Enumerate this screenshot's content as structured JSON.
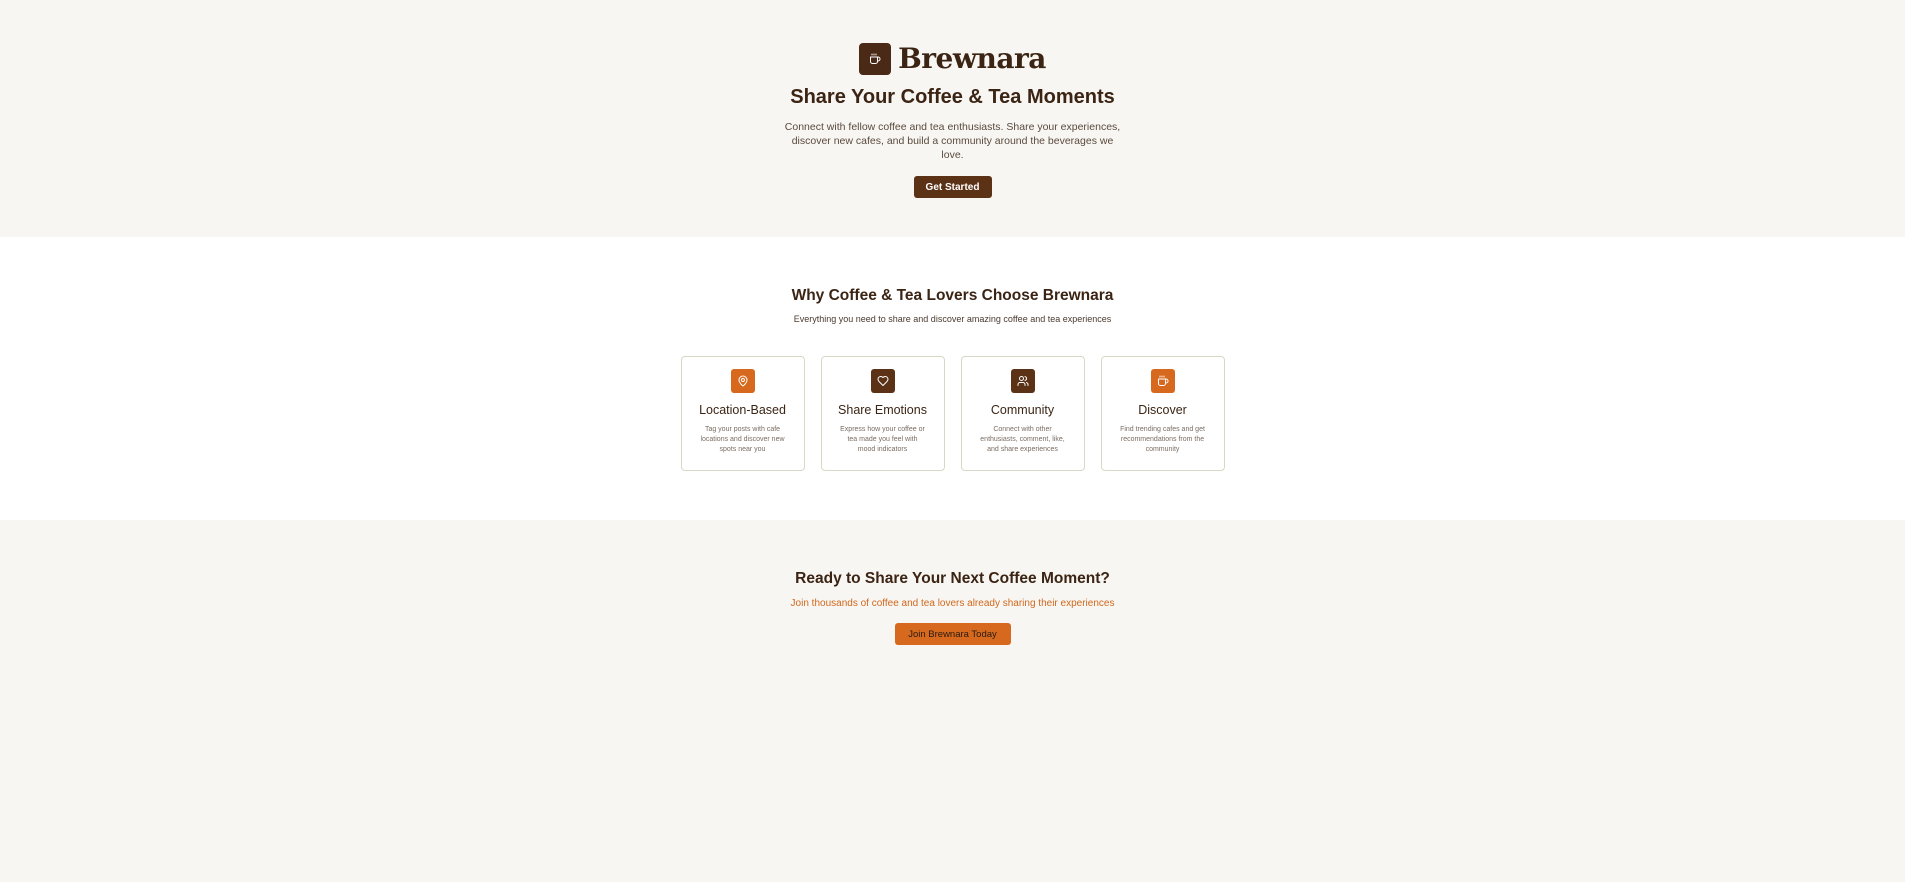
{
  "hero": {
    "brand_name": "Brewnara",
    "logo_icon": "coffee-cup-icon",
    "title": "Share Your Coffee & Tea Moments",
    "description": "Connect with fellow coffee and tea enthusiasts. Share your experiences, discover new cafes, and build a community around the beverages we love.",
    "cta_label": "Get Started"
  },
  "features": {
    "title": "Why Coffee & Tea Lovers Choose Brewnara",
    "subtitle": "Everything you need to share and discover amazing coffee and tea experiences",
    "cards": [
      {
        "icon": "map-pin-icon",
        "title": "Location-Based",
        "description": "Tag your posts with cafe locations and discover new spots near you",
        "color": "#d6691d"
      },
      {
        "icon": "heart-icon",
        "title": "Share Emotions",
        "description": "Express how your coffee or tea made you feel with mood indicators",
        "color": "#5b3216"
      },
      {
        "icon": "users-icon",
        "title": "Community",
        "description": "Connect with other enthusiasts, comment, like, and share experiences",
        "color": "#5b3216"
      },
      {
        "icon": "coffee-cup-icon",
        "title": "Discover",
        "description": "Find trending cafes and get recommendations from the community",
        "color": "#d6691d"
      }
    ]
  },
  "cta": {
    "title": "Ready to Share Your Next Coffee Moment?",
    "subtitle": "Join thousands of coffee and tea lovers already sharing their experiences",
    "button_label": "Join Brewnara Today"
  },
  "colors": {
    "dark_brown": "#5b3216",
    "orange": "#d6691d",
    "page_bg": "#f8f6f2"
  }
}
